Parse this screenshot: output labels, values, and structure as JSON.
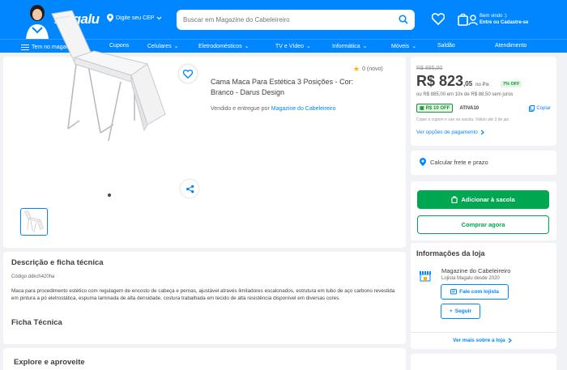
{
  "header": {
    "logo": "Magalu",
    "cep_label": "Digite seu CEP",
    "search_placeholder": "Buscar em Magazine do Cabeleireiro",
    "welcome_line1": "Bem vindo :)",
    "welcome_line2": "Entre ou Cadastre-se"
  },
  "nav": {
    "items": [
      {
        "label": "Tem no magalu"
      },
      {
        "label": "Cupons"
      },
      {
        "label": "Celulares"
      },
      {
        "label": "Eletrodomésticos"
      },
      {
        "label": "TV e Vídeo"
      },
      {
        "label": "Informática"
      },
      {
        "label": "Móveis"
      },
      {
        "label": "Saldão"
      },
      {
        "label": "Atendimento"
      }
    ]
  },
  "product": {
    "rating": "0 (novo)",
    "title": "Cama Maca Para Estética 3 Posições - Cor: Branco - Darus Design",
    "sold_by_prefix": "Vendido e entregue por",
    "seller": "Magazine do Cabeleireiro"
  },
  "price": {
    "old": "R$ 885,00",
    "main": "R$ 823",
    "cents": ",05",
    "pix": "no Pix",
    "off_badge": "7% OFF",
    "installments": "ou R$ 885,00 em 10x de R$ 88,50 sem juros",
    "coupon_label": "R$ 10 OFF",
    "coupon_code": "ATIVA10",
    "copy_label": "Copiar",
    "coupon_note": "Copie o cupom e use na sacola. Válido até 3 de jan",
    "payment_link": "Ver opções de pagamento"
  },
  "frete": {
    "label": "Calcular frete e prazo"
  },
  "buy": {
    "add_to_cart": "Adicionar à sacola",
    "buy_now": "Comprar agora"
  },
  "store": {
    "section_title": "Informações da loja",
    "name": "Magazine do Cabeleireiro",
    "since": "Lojista Magalu desde 2020",
    "chat": "Fale com lojista",
    "follow": "Seguir",
    "more": "Ver mais sobre a loja"
  },
  "description": {
    "title": "Descrição e ficha técnica",
    "code": "Código ddkch420ha",
    "text": "Maca para procedimento estético com regulagem de encosto de cabeça e pernas, ajustável através limitadores escalonados, estrutura em tubo de aço carbono revestida em pintura a pó eletrostática, espuma laminada de alta densidade, costura trabalhada em tecido de alta resistência disponível em diversas cores.",
    "ficha_title": "Ficha Técnica"
  },
  "explore": {
    "title": "Explore e aproveite"
  },
  "colors": {
    "brand": "#0086ff",
    "green": "#00a650"
  }
}
